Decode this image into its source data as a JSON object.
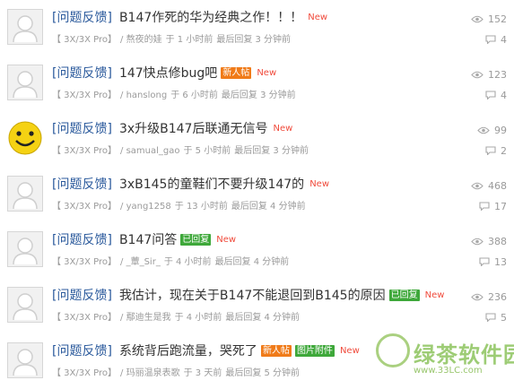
{
  "threads": [
    {
      "category": "[问题反馈]",
      "subject": "B147作死的华为经典之作！！！",
      "badges": [],
      "new": "New",
      "forum": "【 3X/3X Pro】",
      "author": "/ 熬夜的娃",
      "posted": "于 1 小时前",
      "last_reply": "最后回复 3 分钟前",
      "views": "152",
      "replies": "4",
      "avatar": "default"
    },
    {
      "category": "[问题反馈]",
      "subject": "147快点修bug吧",
      "badges": [
        {
          "label": "新人帖",
          "type": "newbie"
        }
      ],
      "new": "New",
      "forum": "【 3X/3X Pro】",
      "author": "/ hanslong",
      "posted": "于 6 小时前",
      "last_reply": "最后回复 3 分钟前",
      "views": "123",
      "replies": "4",
      "avatar": "default"
    },
    {
      "category": "[问题反馈]",
      "subject": "3x升级B147后联通无信号",
      "badges": [],
      "new": "New",
      "forum": "【 3X/3X Pro】",
      "author": "/ samual_gao",
      "posted": "于 5 小时前",
      "last_reply": "最后回复 3 分钟前",
      "views": "99",
      "replies": "2",
      "avatar": "smiley"
    },
    {
      "category": "[问题反馈]",
      "subject": "3xB145的童鞋们不要升级147的",
      "badges": [],
      "new": "New",
      "forum": "【 3X/3X Pro】",
      "author": "/ yang1258",
      "posted": "于 13 小时前",
      "last_reply": "最后回复 4 分钟前",
      "views": "468",
      "replies": "17",
      "avatar": "default"
    },
    {
      "category": "[问题反馈]",
      "subject": "B147问答",
      "badges": [
        {
          "label": "已回复",
          "type": "replied"
        }
      ],
      "new": "New",
      "forum": "【 3X/3X Pro】",
      "author": "/ _蕈_Sir_",
      "posted": "于 4 小时前",
      "last_reply": "最后回复 4 分钟前",
      "views": "388",
      "replies": "13",
      "avatar": "default"
    },
    {
      "category": "[问题反馈]",
      "subject": "我估计，现在关于B147不能退回到B145的原因",
      "badges": [
        {
          "label": "已回复",
          "type": "replied"
        }
      ],
      "new": "New",
      "forum": "【 3X/3X Pro】",
      "author": "/ 鄢迪生是我",
      "posted": "于 4 小时前",
      "last_reply": "最后回复 4 分钟前",
      "views": "236",
      "replies": "5",
      "avatar": "default"
    },
    {
      "category": "[问题反馈]",
      "subject": "系统背后跑流量，哭死了",
      "badges": [
        {
          "label": "新人帖",
          "type": "newbie"
        },
        {
          "label": "图片附件",
          "type": "pic"
        }
      ],
      "new": "New",
      "forum": "【 3X/3X Pro】",
      "author": "/ 玛丽温泉表歌",
      "posted": "于 3 天前",
      "last_reply": "最后回复 5 分钟前",
      "views": "",
      "replies": "",
      "avatar": "default"
    }
  ],
  "watermark": {
    "text": "绿茶软件园",
    "url": "www.33LC.com"
  },
  "colors": {
    "category": "#2b5a9c",
    "new": "#f04b3c",
    "newbie_badge": "#f07b19",
    "replied_badge": "#3ea83a",
    "meta": "#9a9a9a",
    "watermark": "#7dbb47"
  },
  "icons": {
    "views": "eye-icon",
    "replies": "speech-bubble-icon"
  }
}
